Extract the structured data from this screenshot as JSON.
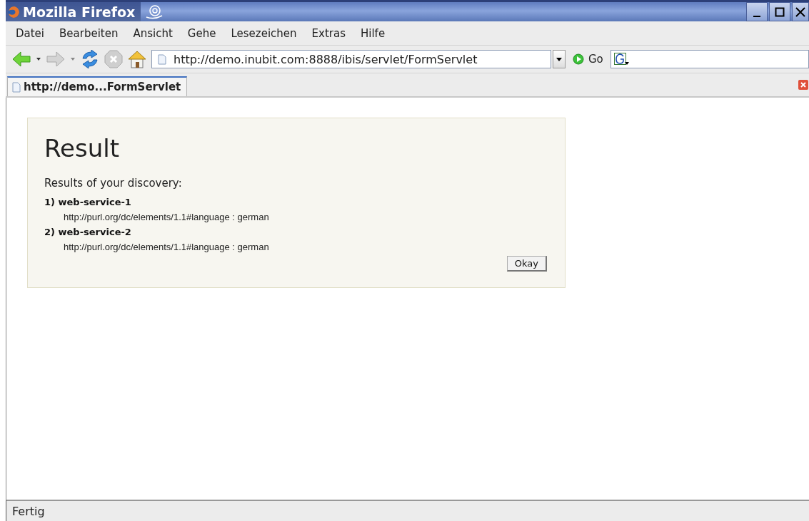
{
  "window": {
    "title": "Mozilla Firefox"
  },
  "menu_bar": [
    {
      "label": "Datei"
    },
    {
      "label": "Bearbeiten"
    },
    {
      "label": "Ansicht"
    },
    {
      "label": "Gehe"
    },
    {
      "label": "Lesezeichen"
    },
    {
      "label": "Extras"
    },
    {
      "label": "Hilfe"
    }
  ],
  "toolbar": {
    "address": "http://demo.inubit.com:8888/ibis/servlet/FormServlet",
    "go_label": "Go",
    "forward_disabled": true,
    "stop_disabled": true
  },
  "tabs": [
    {
      "label": "http://demo...FormServlet",
      "selected": true
    }
  ],
  "page": {
    "heading": "Result",
    "intro": "Results of your discovery:",
    "results": [
      {
        "title": "1) web-service-1",
        "detail": "http://purl.org/dc/elements/1.1#language : german"
      },
      {
        "title": "2) web-service-2",
        "detail": "http://purl.org/dc/elements/1.1#language : german"
      }
    ],
    "button": "Okay"
  },
  "status_bar": "Fertig"
}
